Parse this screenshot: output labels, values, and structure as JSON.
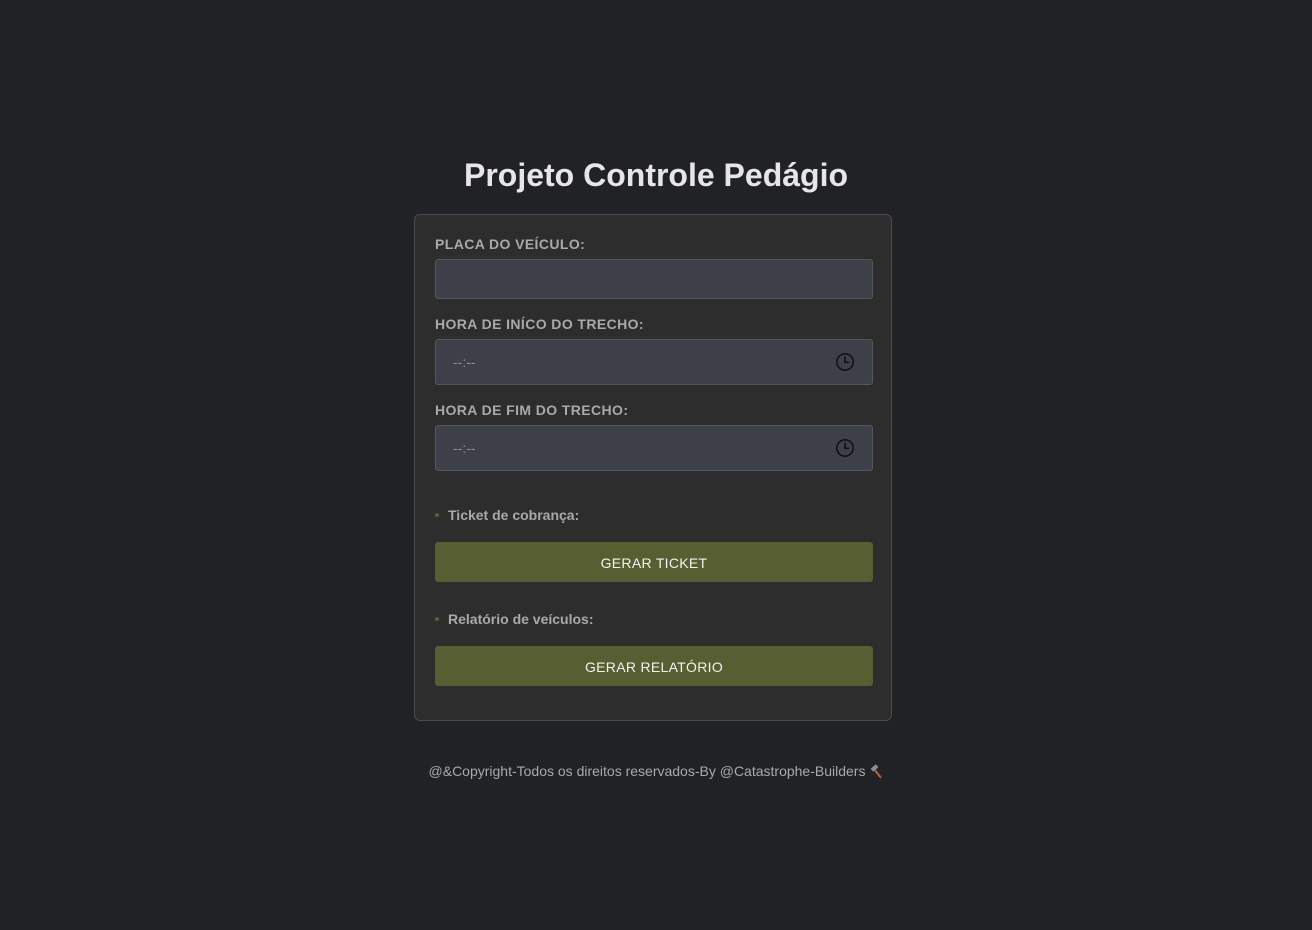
{
  "header": {
    "title": "Projeto Controle Pedágio"
  },
  "form": {
    "placa_label": "PLACA DO VEÍCULO:",
    "placa_value": "",
    "inicio_label": "HORA DE INÍCO DO TRECHO:",
    "inicio_placeholder": "--:--",
    "fim_label": "HORA DE FIM DO TRECHO:",
    "fim_placeholder": "--:--",
    "ticket_section_label": "Ticket de cobrança:",
    "ticket_button": "GERAR TICKET",
    "relatorio_section_label": "Relatório de veículos:",
    "relatorio_button": "GERAR RELATÓRIO"
  },
  "footer": {
    "text": "@&Copyright-Todos os direitos reservados-By @Catastrophe-Builders",
    "icon": "hammer-icon"
  },
  "colors": {
    "background": "#212226",
    "card": "#2d2d2d",
    "input": "#3e4049",
    "button": "#565e32",
    "text_muted": "#a9a9a9"
  }
}
